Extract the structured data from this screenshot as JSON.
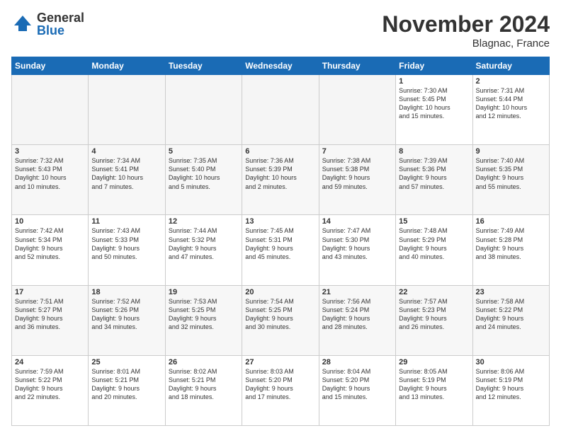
{
  "logo": {
    "general": "General",
    "blue": "Blue"
  },
  "title": "November 2024",
  "location": "Blagnac, France",
  "days_of_week": [
    "Sunday",
    "Monday",
    "Tuesday",
    "Wednesday",
    "Thursday",
    "Friday",
    "Saturday"
  ],
  "weeks": [
    {
      "days": [
        {
          "num": "",
          "info": "",
          "empty": true
        },
        {
          "num": "",
          "info": "",
          "empty": true
        },
        {
          "num": "",
          "info": "",
          "empty": true
        },
        {
          "num": "",
          "info": "",
          "empty": true
        },
        {
          "num": "",
          "info": "",
          "empty": true
        },
        {
          "num": "1",
          "info": "Sunrise: 7:30 AM\nSunset: 5:45 PM\nDaylight: 10 hours\nand 15 minutes."
        },
        {
          "num": "2",
          "info": "Sunrise: 7:31 AM\nSunset: 5:44 PM\nDaylight: 10 hours\nand 12 minutes."
        }
      ]
    },
    {
      "days": [
        {
          "num": "3",
          "info": "Sunrise: 7:32 AM\nSunset: 5:43 PM\nDaylight: 10 hours\nand 10 minutes."
        },
        {
          "num": "4",
          "info": "Sunrise: 7:34 AM\nSunset: 5:41 PM\nDaylight: 10 hours\nand 7 minutes."
        },
        {
          "num": "5",
          "info": "Sunrise: 7:35 AM\nSunset: 5:40 PM\nDaylight: 10 hours\nand 5 minutes."
        },
        {
          "num": "6",
          "info": "Sunrise: 7:36 AM\nSunset: 5:39 PM\nDaylight: 10 hours\nand 2 minutes."
        },
        {
          "num": "7",
          "info": "Sunrise: 7:38 AM\nSunset: 5:38 PM\nDaylight: 9 hours\nand 59 minutes."
        },
        {
          "num": "8",
          "info": "Sunrise: 7:39 AM\nSunset: 5:36 PM\nDaylight: 9 hours\nand 57 minutes."
        },
        {
          "num": "9",
          "info": "Sunrise: 7:40 AM\nSunset: 5:35 PM\nDaylight: 9 hours\nand 55 minutes."
        }
      ]
    },
    {
      "days": [
        {
          "num": "10",
          "info": "Sunrise: 7:42 AM\nSunset: 5:34 PM\nDaylight: 9 hours\nand 52 minutes."
        },
        {
          "num": "11",
          "info": "Sunrise: 7:43 AM\nSunset: 5:33 PM\nDaylight: 9 hours\nand 50 minutes."
        },
        {
          "num": "12",
          "info": "Sunrise: 7:44 AM\nSunset: 5:32 PM\nDaylight: 9 hours\nand 47 minutes."
        },
        {
          "num": "13",
          "info": "Sunrise: 7:45 AM\nSunset: 5:31 PM\nDaylight: 9 hours\nand 45 minutes."
        },
        {
          "num": "14",
          "info": "Sunrise: 7:47 AM\nSunset: 5:30 PM\nDaylight: 9 hours\nand 43 minutes."
        },
        {
          "num": "15",
          "info": "Sunrise: 7:48 AM\nSunset: 5:29 PM\nDaylight: 9 hours\nand 40 minutes."
        },
        {
          "num": "16",
          "info": "Sunrise: 7:49 AM\nSunset: 5:28 PM\nDaylight: 9 hours\nand 38 minutes."
        }
      ]
    },
    {
      "days": [
        {
          "num": "17",
          "info": "Sunrise: 7:51 AM\nSunset: 5:27 PM\nDaylight: 9 hours\nand 36 minutes."
        },
        {
          "num": "18",
          "info": "Sunrise: 7:52 AM\nSunset: 5:26 PM\nDaylight: 9 hours\nand 34 minutes."
        },
        {
          "num": "19",
          "info": "Sunrise: 7:53 AM\nSunset: 5:25 PM\nDaylight: 9 hours\nand 32 minutes."
        },
        {
          "num": "20",
          "info": "Sunrise: 7:54 AM\nSunset: 5:25 PM\nDaylight: 9 hours\nand 30 minutes."
        },
        {
          "num": "21",
          "info": "Sunrise: 7:56 AM\nSunset: 5:24 PM\nDaylight: 9 hours\nand 28 minutes."
        },
        {
          "num": "22",
          "info": "Sunrise: 7:57 AM\nSunset: 5:23 PM\nDaylight: 9 hours\nand 26 minutes."
        },
        {
          "num": "23",
          "info": "Sunrise: 7:58 AM\nSunset: 5:22 PM\nDaylight: 9 hours\nand 24 minutes."
        }
      ]
    },
    {
      "days": [
        {
          "num": "24",
          "info": "Sunrise: 7:59 AM\nSunset: 5:22 PM\nDaylight: 9 hours\nand 22 minutes."
        },
        {
          "num": "25",
          "info": "Sunrise: 8:01 AM\nSunset: 5:21 PM\nDaylight: 9 hours\nand 20 minutes."
        },
        {
          "num": "26",
          "info": "Sunrise: 8:02 AM\nSunset: 5:21 PM\nDaylight: 9 hours\nand 18 minutes."
        },
        {
          "num": "27",
          "info": "Sunrise: 8:03 AM\nSunset: 5:20 PM\nDaylight: 9 hours\nand 17 minutes."
        },
        {
          "num": "28",
          "info": "Sunrise: 8:04 AM\nSunset: 5:20 PM\nDaylight: 9 hours\nand 15 minutes."
        },
        {
          "num": "29",
          "info": "Sunrise: 8:05 AM\nSunset: 5:19 PM\nDaylight: 9 hours\nand 13 minutes."
        },
        {
          "num": "30",
          "info": "Sunrise: 8:06 AM\nSunset: 5:19 PM\nDaylight: 9 hours\nand 12 minutes."
        }
      ]
    }
  ]
}
